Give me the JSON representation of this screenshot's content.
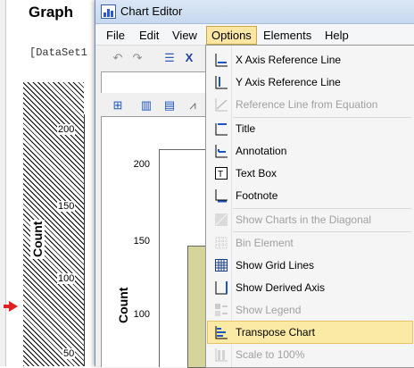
{
  "background": {
    "graph_title": "Graph",
    "dataset_text": "[DataSet1",
    "y_axis_label": "Count",
    "ticks": [
      "200",
      "150",
      "100",
      "50"
    ]
  },
  "window": {
    "title": "Chart Editor",
    "menus": [
      "File",
      "Edit",
      "View",
      "Options",
      "Elements",
      "Help"
    ],
    "active_menu": "Options"
  },
  "chart": {
    "y_axis_label": "Count",
    "ticks": [
      "200",
      "150",
      "100"
    ]
  },
  "options_menu": {
    "items": [
      {
        "label": "X Axis Reference Line",
        "icon": "x-axis-reference-line-icon",
        "enabled": true
      },
      {
        "label": "Y Axis Reference Line",
        "icon": "y-axis-reference-line-icon",
        "enabled": true
      },
      {
        "label": "Reference Line from Equation",
        "icon": "equation-line-icon",
        "enabled": false
      },
      {
        "label": "Title",
        "icon": "title-icon",
        "enabled": true
      },
      {
        "label": "Annotation",
        "icon": "annotation-icon",
        "enabled": true
      },
      {
        "label": "Text Box",
        "icon": "text-box-icon",
        "enabled": true
      },
      {
        "label": "Footnote",
        "icon": "footnote-icon",
        "enabled": true
      },
      {
        "label": "Show Charts in the Diagonal",
        "icon": "diagonal-charts-icon",
        "enabled": false
      },
      {
        "label": "Bin Element",
        "icon": "bin-element-icon",
        "enabled": false
      },
      {
        "label": "Show Grid Lines",
        "icon": "grid-lines-icon",
        "enabled": true
      },
      {
        "label": "Show Derived Axis",
        "icon": "derived-axis-icon",
        "enabled": true
      },
      {
        "label": "Show Legend",
        "icon": "legend-icon",
        "enabled": false
      },
      {
        "label": "Transpose Chart",
        "icon": "transpose-chart-icon",
        "enabled": true,
        "highlighted": true
      },
      {
        "label": "Scale to 100%",
        "icon": "scale-100-icon",
        "enabled": false
      }
    ]
  }
}
